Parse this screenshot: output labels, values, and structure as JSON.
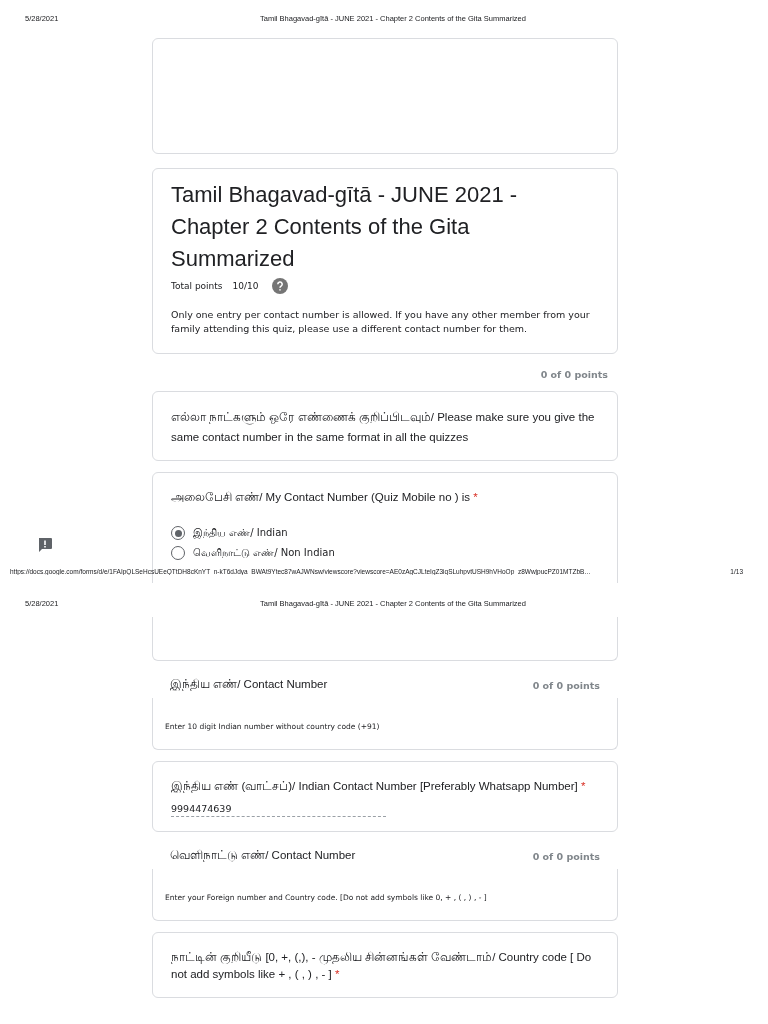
{
  "pages": [
    {
      "header": {
        "date": "5/28/2021",
        "title": "Tamil Bhagavad-gītā - JUNE 2021 - Chapter 2 Contents of the Gita Summarized"
      },
      "items": [
        {
          "kind": "banner"
        },
        {
          "kind": "title",
          "title": "Tamil Bhagavad-gītā - JUNE 2021 - Chapter 2 Contents of the Gita Summarized",
          "points_label": "Total points",
          "points": "10/10",
          "description": "Only one entry per contact number is allowed. If you have any other member from your family attending this quiz, please use a different contact number for them."
        },
        {
          "kind": "points",
          "points": "0 of 0 points"
        },
        {
          "kind": "text",
          "text": "எல்லா நாட்களும் ஒரே எண்ணைக் குறிப்பிடவும்/ Please make sure you give the same contact number in the same format in all the quizzes"
        },
        {
          "kind": "radio",
          "question": "அலைபேசி எண்/ My Contact Number (Quiz Mobile no ) is",
          "required_mark": "*",
          "options": [
            {
              "label": "இந்திய எண்/ Indian",
              "selected": true
            },
            {
              "label": "வெளிநாட்டு எண்/ Non Indian",
              "selected": false
            }
          ]
        }
      ],
      "footer": {
        "url": "https://docs.google.com/forms/d/e/1FAIpQLSeHcsUEeQTtDH8cKnYT_n-kT6dJdya_BWAt9Ytec87wAJWNsw/viewscore?viewscore=AE0zAgCJLteIgZ3iqSLuhpvtUSH9hVHoOp_z8WwjpucPZ01MTZbB…",
        "page": "1/13"
      }
    },
    {
      "header": {
        "date": "5/28/2021",
        "title": "Tamil Bhagavad-gītā - JUNE 2021 - Chapter 2 Contents of the Gita Summarized"
      },
      "items": [
        {
          "kind": "continuation"
        },
        {
          "kind": "section",
          "title": "இந்திய எண்/ Contact Number",
          "points": "0 of 0 points",
          "description": "Enter 10 digit Indian number without country code (+91)"
        },
        {
          "kind": "short_answer",
          "question": "இந்திய எண் (வாட்சப்)/ Indian Contact Number [Preferably Whatsapp Number]",
          "required_mark": "*",
          "value": "9994474639"
        },
        {
          "kind": "section",
          "title": "வெளிநாட்டு எண்/ Contact Number",
          "points": "0 of 0 points",
          "description": "Enter your Foreign number and Country code. [Do not add symbols like 0, + , ( , ) , - ]"
        },
        {
          "kind": "short_answer",
          "question": "நாட்டின் குறியீடு [0, +, (,), - முதலிய சின்னங்கள் வேண்டாம்/ Country code [ Do not add symbols like + , ( , ) , - ]",
          "required_mark": "*"
        }
      ]
    }
  ]
}
